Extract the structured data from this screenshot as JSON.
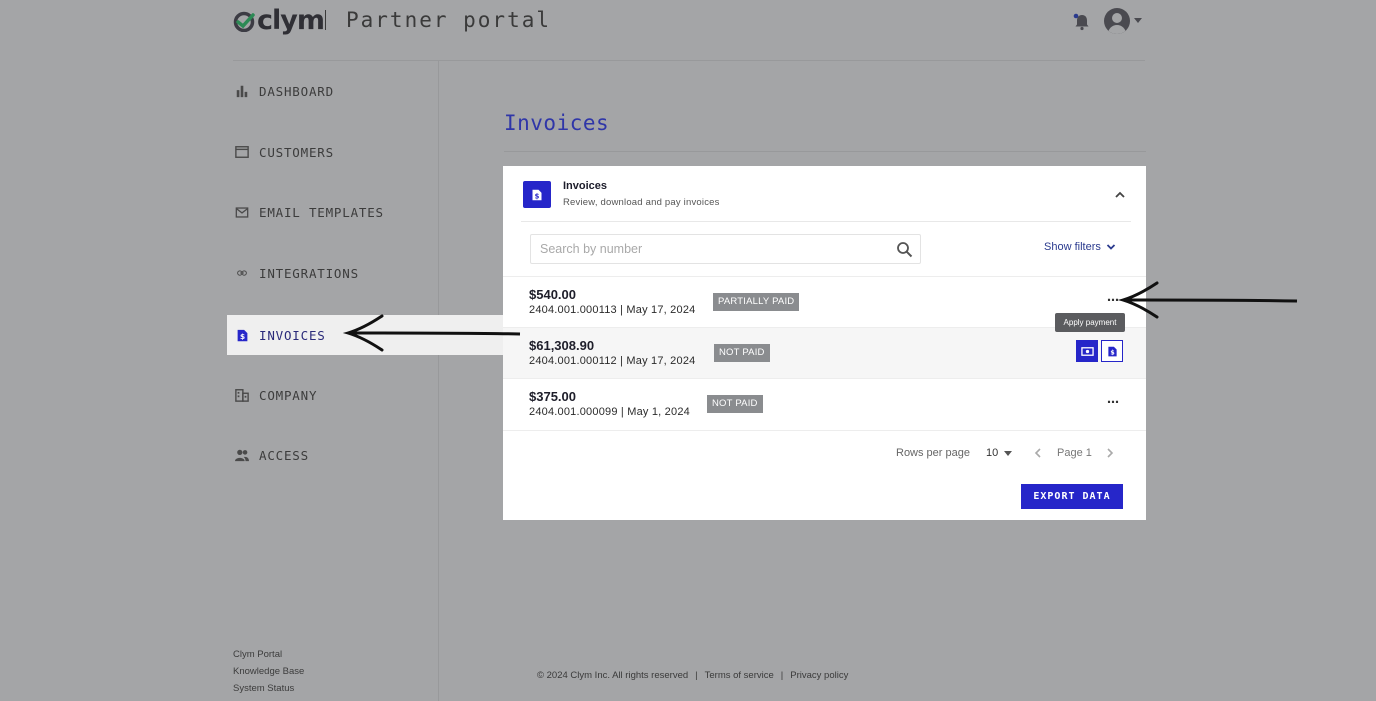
{
  "brand": {
    "logo_text": "clym",
    "portal_title": "Partner portal"
  },
  "header": {
    "bell_icon": "notification-bell-icon",
    "avatar_icon": "user-avatar-icon"
  },
  "sidebar": {
    "items": [
      {
        "label": "DASHBOARD",
        "icon": "bar-chart-icon"
      },
      {
        "label": "CUSTOMERS",
        "icon": "folder-icon"
      },
      {
        "label": "EMAIL TEMPLATES",
        "icon": "envelope-icon"
      },
      {
        "label": "INTEGRATIONS",
        "icon": "link-icon"
      },
      {
        "label": "INVOICES",
        "icon": "invoice-icon",
        "active": true
      },
      {
        "label": "COMPANY",
        "icon": "building-icon"
      },
      {
        "label": "ACCESS",
        "icon": "people-icon"
      }
    ],
    "footer_links": [
      "Clym Portal",
      "Knowledge Base",
      "System Status"
    ]
  },
  "main": {
    "page_title": "Invoices",
    "card": {
      "title": "Invoices",
      "subtitle": "Review, download and pay invoices",
      "search_placeholder": "Search by number",
      "show_filters": "Show filters",
      "invoices": [
        {
          "amount": "$540.00",
          "meta": "2404.001.000113 | May 17, 2024",
          "status": "PARTIALLY PAID"
        },
        {
          "amount": "$61,308.90",
          "meta": "2404.001.000112 | May 17, 2024",
          "status": "NOT PAID"
        },
        {
          "amount": "$375.00",
          "meta": "2404.001.000099 | May 1, 2024",
          "status": "NOT PAID"
        }
      ],
      "more_actions": "⋯",
      "tooltip": "Apply payment",
      "rows_per_page_label": "Rows per page",
      "rows_per_page_value": "10",
      "page_label": "Page 1",
      "export_label": "EXPORT DATA"
    }
  },
  "footer": {
    "copyright": "© 2024 Clym Inc. All rights reserved",
    "terms": "Terms of service",
    "privacy": "Privacy policy"
  },
  "colors": {
    "accent": "#2626c9",
    "title": "#2f36a8",
    "overlay_bg": "#a4a5a7",
    "badge": "#8a8c8f"
  }
}
